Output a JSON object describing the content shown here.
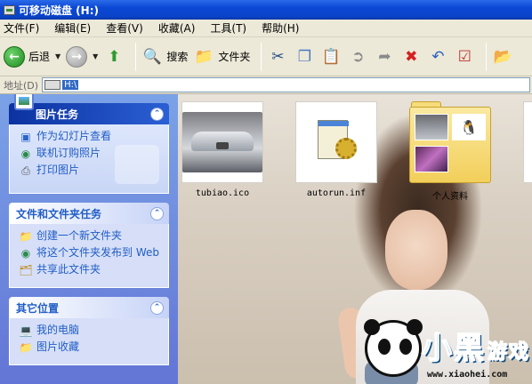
{
  "window": {
    "title": "可移动磁盘  (H:)"
  },
  "menu": [
    "文件(F)",
    "编辑(E)",
    "查看(V)",
    "收藏(A)",
    "工具(T)",
    "帮助(H)"
  ],
  "toolbar": {
    "back_label": "后退",
    "search_label": "搜索",
    "folders_label": "文件夹"
  },
  "address": {
    "label": "地址(D)",
    "value": "H:\\"
  },
  "tasks": {
    "picture": {
      "title": "图片任务",
      "items": [
        "作为幻灯片查看",
        "联机订购照片",
        "打印图片"
      ]
    },
    "file": {
      "title": "文件和文件夹任务",
      "items": [
        "创建一个新文件夹",
        "将这个文件夹发布到 Web",
        "共享此文件夹"
      ]
    },
    "other": {
      "title": "其它位置",
      "items": [
        "我的电脑",
        "图片收藏"
      ]
    }
  },
  "files": [
    {
      "name": "tubiao.ico",
      "type": "image"
    },
    {
      "name": "autorun.inf",
      "type": "inf"
    },
    {
      "name": "个人资料",
      "type": "folder"
    }
  ],
  "watermark": {
    "brand": "小黑",
    "brand2": "游戏",
    "url": "www.xiaohei.com"
  },
  "colors": {
    "title_bar": "#0a48d4",
    "task_pane": "#6375d6",
    "link": "#215dc6"
  }
}
